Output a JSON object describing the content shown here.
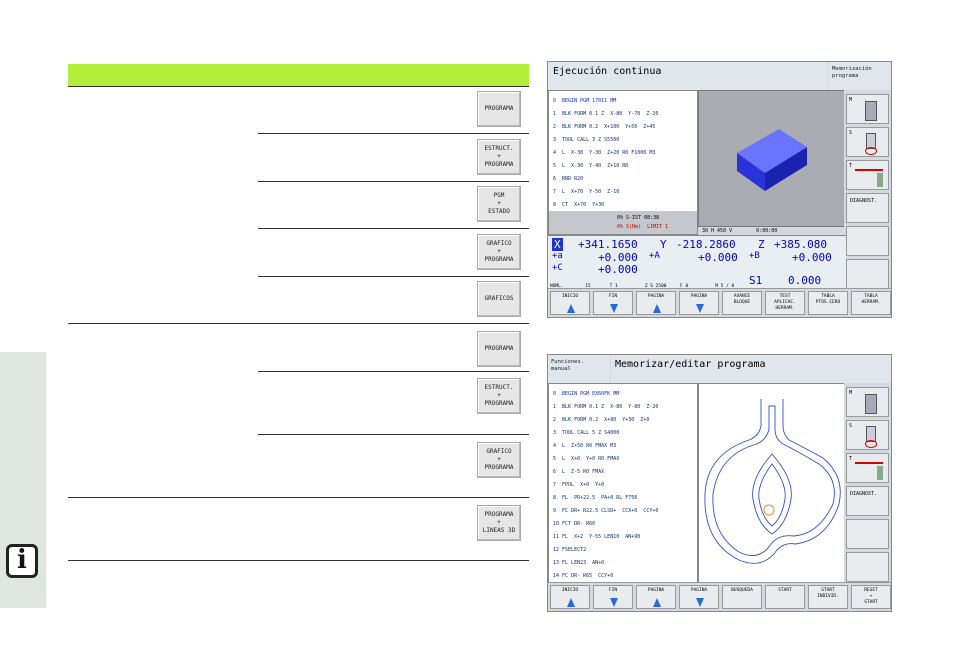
{
  "softkeys_table": [
    {
      "label": "PROGRAMA"
    },
    {
      "label": "ESTRUCT.\n+\nPROGRAMA"
    },
    {
      "label": "PGM\n+\nESTADO"
    },
    {
      "label": "GRAFICO\n+\nPROGRAMA"
    },
    {
      "label": "GRAFICOS"
    },
    {
      "label": "PROGRAMA"
    },
    {
      "label": "ESTRUCT.\n+\nPROGRAMA"
    },
    {
      "label": "GRAFICO\n+\nPROGRAMA"
    },
    {
      "label": "PROGRAMA\n+\nLINEAS 3D"
    }
  ],
  "screen1": {
    "title": "Ejecución continua",
    "side_title": "Memorización\nprograma",
    "program": [
      "0  BEGIN PGM 17011 MM",
      "1  BLK FORM 0.1 Z  X-80  Y-70  Z-20",
      "2  BLK FORM 0.2  X+100  Y+50  Z+45",
      "3  TOOL CALL 3 Z S5500",
      "4  L  X-30  Y-30  Z+20 R0 F1000 M3",
      "5  L  X-30  Y-40  Z+10 RR",
      "6  RND R20",
      "7  L  X+70  Y-50  Z-10",
      "8  CT  X+70  Y+30"
    ],
    "status1": "0% S-IST 08:38",
    "status2": "0% S(Nm)  LIMIT 1",
    "graph_status": "30 H 450 V        0:00:00",
    "coords": {
      "x_label": "X",
      "x": "+341.1650",
      "y_label": "Y",
      "y": "-218.2860",
      "z_label": "Z",
      "z": "+385.080",
      "a_label": "+a",
      "a": "+0.000",
      "aa_label": "+A",
      "aa": "+0.000",
      "b_label": "+B",
      "b": "+0.000",
      "c_label": "+C",
      "c": "+0.000",
      "s_label": "S1",
      "s": "0.000"
    },
    "bottom_status": "NOML.        15       T 1          Z S 2500     F 0          M 5 / 8",
    "sidekeys": [
      "M",
      "S",
      "T",
      "DIAGNOST."
    ],
    "softkeys": [
      "INICIO",
      "FIN",
      "PAGINA",
      "PAGINA",
      "AVANCE\nBLOQUE",
      "TEST\nAPLICAC.\nHERRAM.",
      "TABLA\nPTOS.CERO",
      "TABLA\nHERRAM."
    ]
  },
  "screen2": {
    "title": "Memorizar/editar programa",
    "side_title": "Funciones.\nmanual",
    "program": [
      "0  BEGIN PGM EX60FK MM",
      "1  BLK FORM 0.1 Z  X-80  Y-80  Z-20",
      "2  BLK FORM 0.2  X+80  Y+30  Z+0",
      "3  TOOL CALL 5 Z S4000",
      "4  L  Z+50 R0 FMAX M3",
      "5  L  X+0  Y+0 R0 FMAX",
      "6  L  Z-5 R0 FMAX",
      "7  FPOL  X+0  Y+0",
      "8  FL  PR+22.5  PA+0 RL F750",
      "9  FC DR+ R22.5 CLSD+  CCX+0  CCY+0",
      "10 FCT DR- R60",
      "11 FL  X+2  Y-55 LEN10  AN+90",
      "12 FSELECT2",
      "13 FL LEN23  AN+0",
      "14 FC DR- R65  CCY+0"
    ],
    "sidekeys": [
      "M",
      "S",
      "T",
      "DIAGNOST."
    ],
    "softkeys": [
      "INICIO",
      "FIN",
      "PAGINA",
      "PAGINA",
      "BUSQUEDA",
      "START",
      "START\nINDIVID.",
      "RESET\n+\nSTART"
    ]
  },
  "info_glyph": "i"
}
